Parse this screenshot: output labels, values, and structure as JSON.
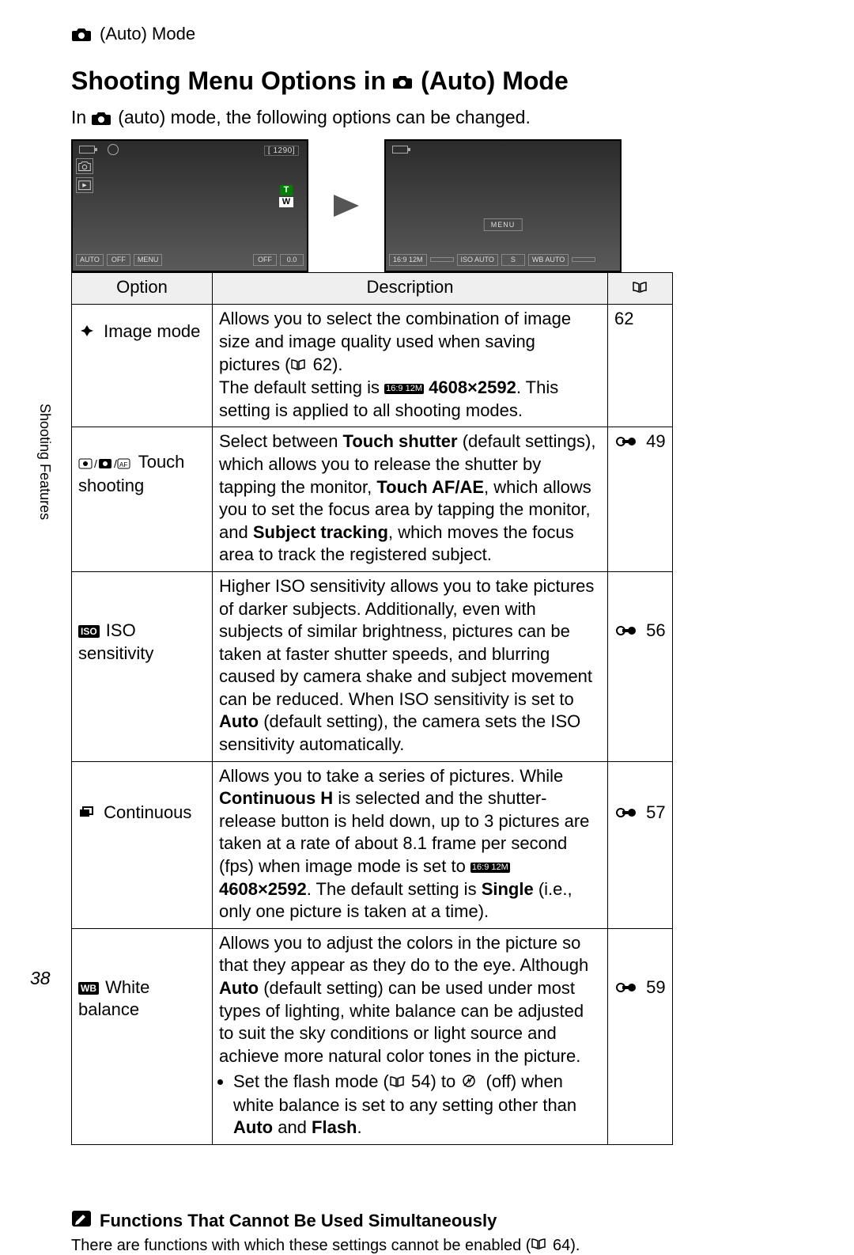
{
  "breadcrumb": {
    "label": "(Auto) Mode"
  },
  "title": {
    "prefix": "Shooting Menu Options in ",
    "suffix": " (Auto) Mode"
  },
  "intro": {
    "prefix": "In ",
    "suffix": " (auto) mode, the following options can be changed."
  },
  "side_tab": "Shooting Features",
  "page_number": "38",
  "screen1": {
    "shots_remaining": "[ 1290]",
    "bottom_left": [
      "AUTO",
      "OFF",
      "MENU"
    ],
    "bottom_right": [
      "OFF",
      "0.0"
    ],
    "tw": {
      "t": "T",
      "w": "W"
    }
  },
  "screen2": {
    "menu_label": "MENU",
    "bottom": [
      "16:9 12M",
      "",
      "ISO AUTO",
      "S",
      "WB AUTO",
      ""
    ]
  },
  "table": {
    "headers": {
      "option": "Option",
      "description": "Description",
      "ref": ""
    },
    "rows": [
      {
        "option_icon": "image-mode",
        "option_label": " Image mode",
        "desc_parts": {
          "p1": "Allows you to select the combination of image size and image quality used when saving pictures (",
          "p1_ref": " 62).",
          "p2a": "The default setting is ",
          "p2_chip": "16:9 12M",
          "p2_bold": " 4608×2592",
          "p2b": ". This setting is applied to all shooting modes."
        },
        "ref": "62",
        "ref_has_link_icon": false
      },
      {
        "option_icon": "touch-shooting",
        "option_label": " Touch shooting",
        "desc_html": "Select between <b>Touch shutter</b> (default settings), which allows you to release the shutter by tapping the monitor, <b>Touch AF/AE</b>, which allows you to set the focus area by tapping the monitor, and <b>Subject tracking</b>, which moves the focus area to track the registered subject.",
        "ref": " 49",
        "ref_has_link_icon": true
      },
      {
        "option_icon": "iso",
        "option_label": " ISO sensitivity",
        "desc_html": "Higher ISO sensitivity allows you to take pictures of darker subjects. Additionally, even with subjects of similar brightness, pictures can be taken at faster shutter speeds, and blurring caused by camera shake and subject movement can be reduced. When ISO sensitivity is set to <b>Auto</b> (default setting), the camera sets the ISO sensitivity automatically.",
        "ref": " 56",
        "ref_has_link_icon": true
      },
      {
        "option_icon": "continuous",
        "option_label": " Continuous",
        "desc_parts": {
          "p1": "Allows you to take a series of pictures. While <b>Continuous H</b> is selected and the shutter-release button is held down, up to 3 pictures are taken at a rate of about 8.1 frame per second (fps) when image mode is set to ",
          "p1_chip": "16:9 12M",
          "p1_bold": " 4608×2592",
          "p1b": ". The default setting is <b>Single</b> (i.e., only one picture is taken at a time)."
        },
        "ref": " 57",
        "ref_has_link_icon": true
      },
      {
        "option_icon": "wb",
        "option_label": " White balance",
        "desc_html": "Allows you to adjust the colors in the picture so that they appear as they do to the eye. Although <b>Auto</b> (default setting) can be used under most types of lighting, white balance can be adjusted to suit the sky conditions or light source and achieve more natural color tones in the picture.",
        "bullet_parts": {
          "pre": "Set the flash mode (",
          "ref": " 54) to ",
          "mid": " (off) when white balance is set to any setting other than ",
          "b1": "Auto",
          "and": " and ",
          "b2": "Flash",
          "end": "."
        },
        "ref": " 59",
        "ref_has_link_icon": true
      }
    ]
  },
  "footnote": {
    "heading": "Functions That Cannot Be Used Simultaneously",
    "body_pre": "There are functions with which these settings cannot be enabled (",
    "body_ref": " 64)."
  },
  "chart_data": {
    "type": "table",
    "title": "Shooting Menu Options in (Auto) Mode",
    "columns": [
      "Option",
      "Description",
      "Reference page"
    ],
    "rows": [
      [
        "Image mode",
        "Select the combination of image size and image quality used when saving pictures (p. 62). Default setting is 4608×2592; applied to all shooting modes.",
        "62"
      ],
      [
        "Touch shooting",
        "Select between Touch shutter (default), Touch AF/AE, and Subject tracking.",
        "49 (reference section)"
      ],
      [
        "ISO sensitivity",
        "Higher ISO sensitivity for darker subjects / faster shutter speeds reducing blur. Default Auto sets ISO automatically.",
        "56 (reference section)"
      ],
      [
        "Continuous",
        "Take a series of pictures. Continuous H: up to 3 pictures at about 8.1 fps when image mode is 4608×2592. Default is Single.",
        "57 (reference section)"
      ],
      [
        "White balance",
        "Adjust colors; Auto default works under most lighting. Set flash mode (p. 54) to off when white balance is set to any setting other than Auto and Flash.",
        "59 (reference section)"
      ]
    ]
  }
}
